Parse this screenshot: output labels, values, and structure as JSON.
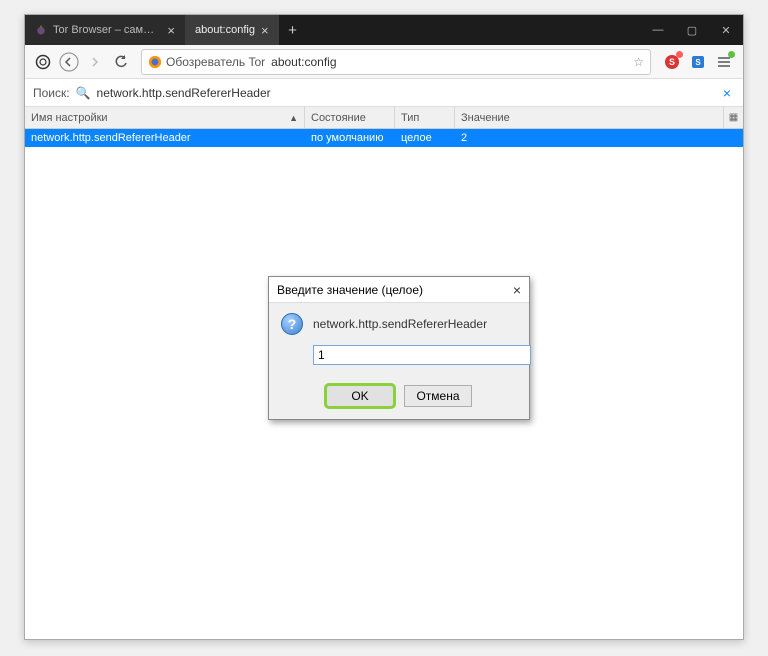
{
  "tabs": [
    {
      "label": "Tor Browser – самый защище",
      "active": false
    },
    {
      "label": "about:config",
      "active": true
    }
  ],
  "nav": {
    "identity_label": "Обозреватель Tor",
    "url": "about:config"
  },
  "search": {
    "label": "Поиск:",
    "value": "network.http.sendRefererHeader"
  },
  "columns": {
    "name": "Имя настройки",
    "state": "Состояние",
    "type": "Тип",
    "value": "Значение"
  },
  "rows": [
    {
      "name": "network.http.sendRefererHeader",
      "state": "по умолчанию",
      "type": "целое",
      "value": "2"
    }
  ],
  "dialog": {
    "title": "Введите значение (целое)",
    "pref_name": "network.http.sendRefererHeader",
    "input_value": "1",
    "ok": "OK",
    "cancel": "Отмена"
  }
}
